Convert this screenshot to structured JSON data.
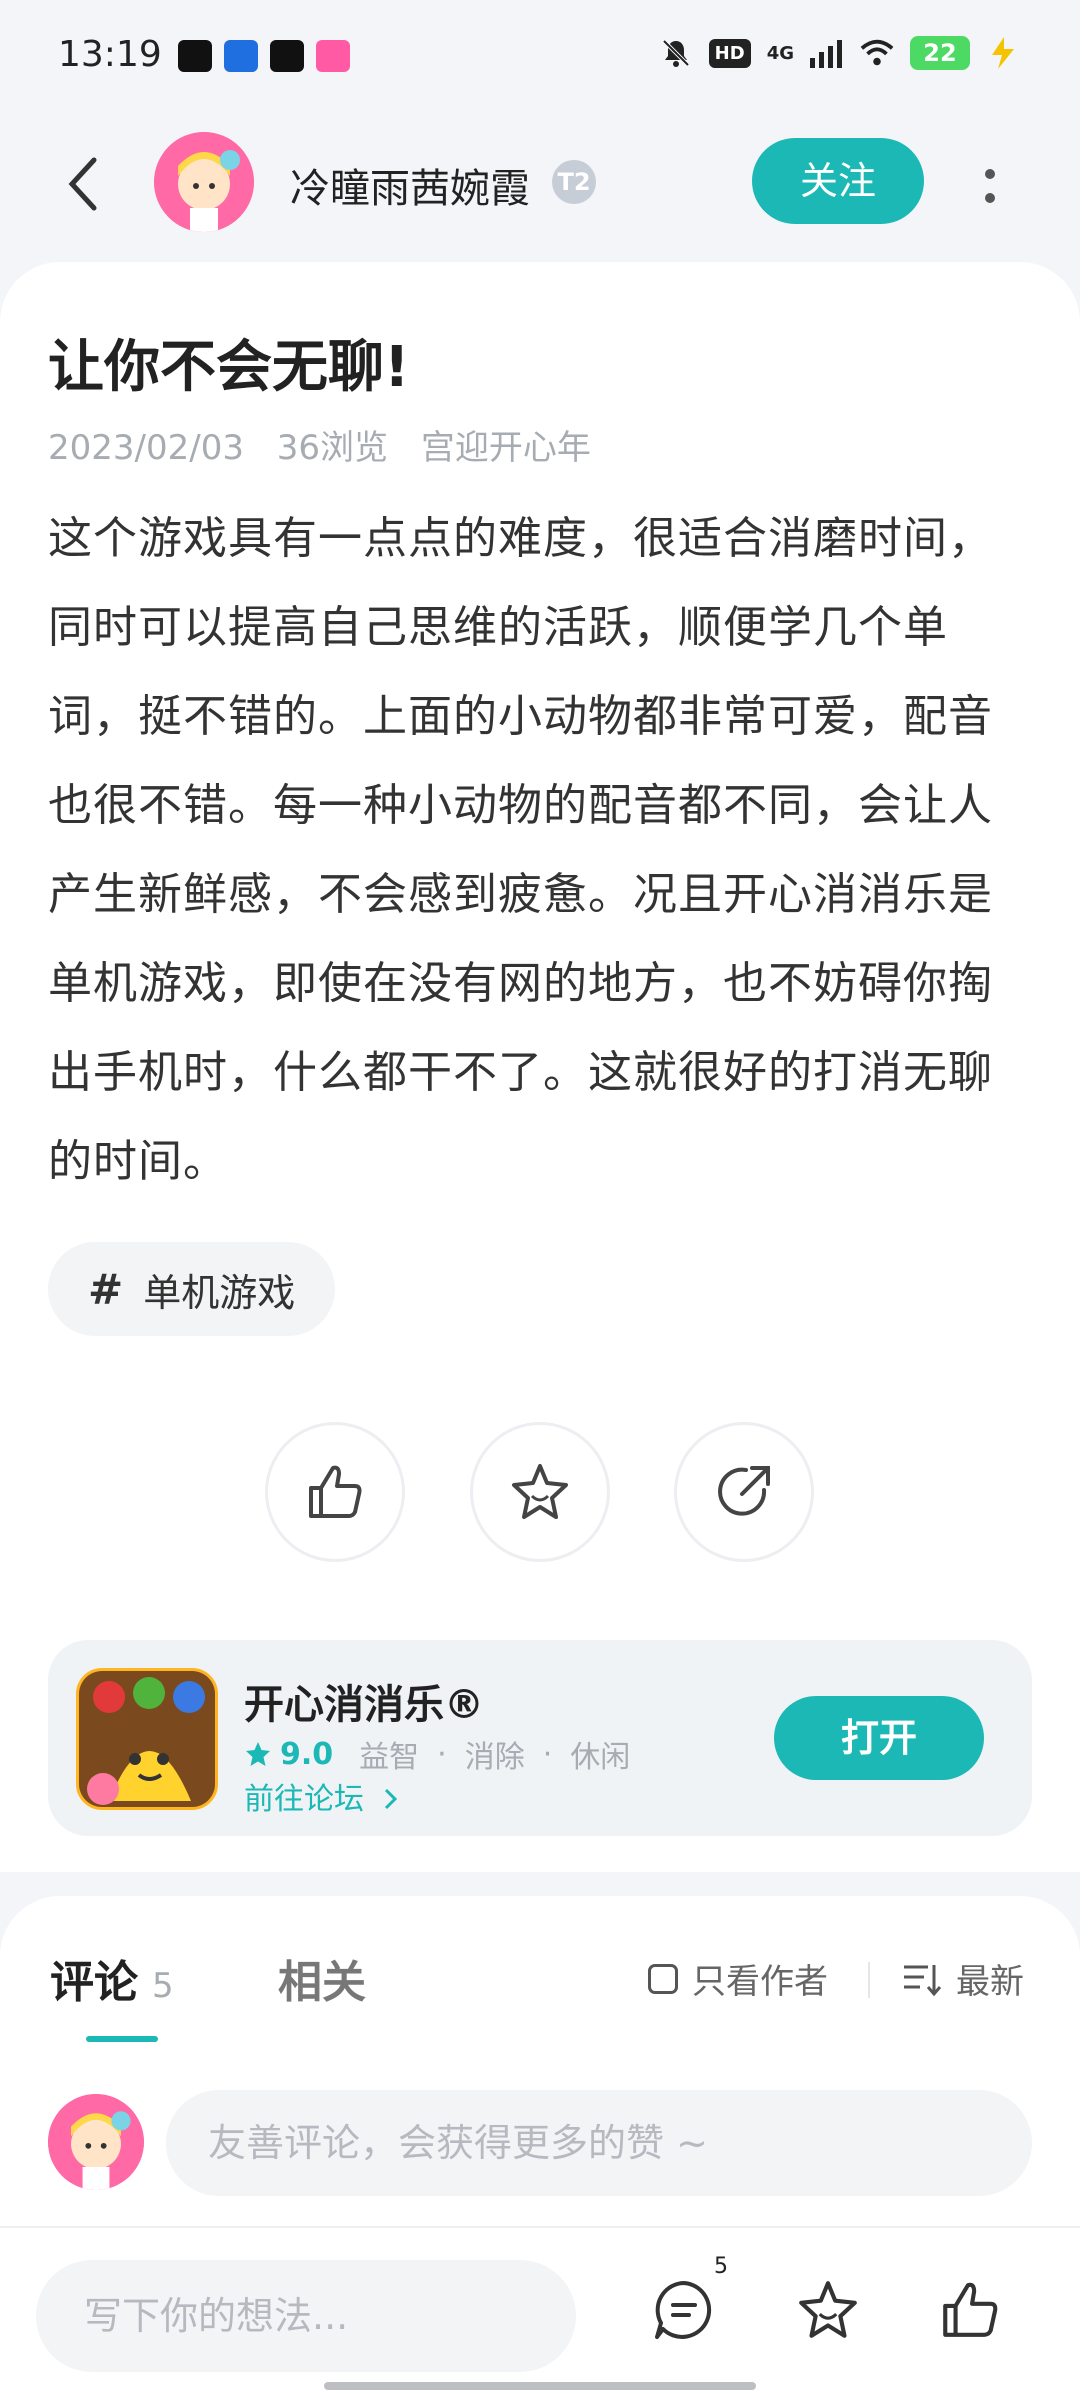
{
  "status_bar": {
    "time": "13:19",
    "network": "4G",
    "hd": "HD",
    "battery": "22"
  },
  "header": {
    "author_name": "冷瞳雨茜婉霞",
    "level_badge": "T2",
    "follow_label": "关注"
  },
  "post": {
    "title": "让你不会无聊!",
    "date": "2023/02/03",
    "views": "36浏览",
    "event": "宫迎开心年",
    "body": "这个游戏具有一点点的难度，很适合消磨时间，同时可以提高自己思维的活跃，顺便学几个单词，挺不错的。上面的小动物都非常可爱，配音也很不错。每一种小动物的配音都不同，会让人产生新鲜感，不会感到疲惫。况且开心消消乐是单机游戏，即使在没有网的地方，也不妨碍你掏出手机时，什么都干不了。这就很好的打消无聊的时间。",
    "topic": "单机游戏"
  },
  "app_card": {
    "name": "开心消消乐®",
    "score": "9.0",
    "tags": [
      "益智",
      "消除",
      "休闲"
    ],
    "forum_link": "前往论坛",
    "open_label": "打开"
  },
  "comments": {
    "tab_comments": "评论",
    "comment_count": "5",
    "tab_related": "相关",
    "author_only": "只看作者",
    "sort_label": "最新",
    "input_placeholder": "友善评论，会获得更多的赞 ~"
  },
  "bottom_bar": {
    "write_placeholder": "写下你的想法...",
    "comment_badge": "5"
  },
  "colors": {
    "accent": "#1bb8b6",
    "background": "#f3f5f8",
    "muted_text": "#a7abb2"
  }
}
